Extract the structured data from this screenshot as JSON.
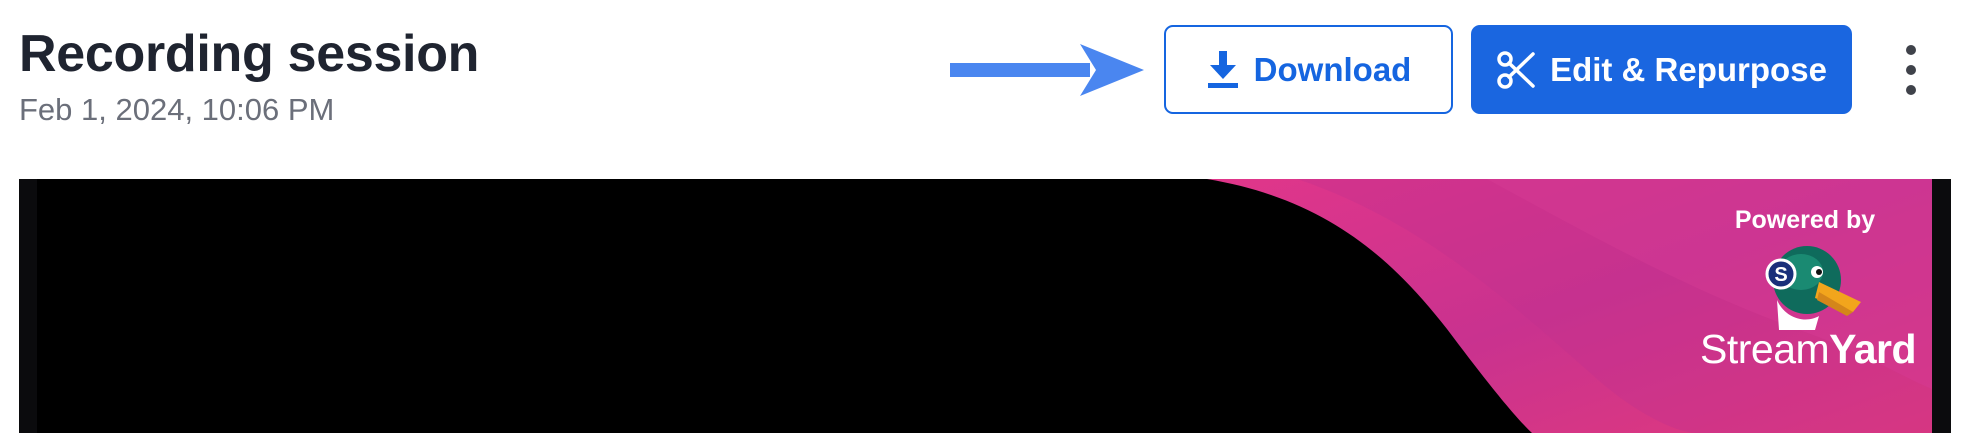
{
  "page": {
    "title": "Recording session",
    "date": "Feb 1, 2024, 10:06 PM"
  },
  "toolbar": {
    "download_label": "Download",
    "edit_label": "Edit & Repurpose",
    "download_icon": "download-icon",
    "edit_icon": "scissors-icon",
    "more_icon": "more-vertical-icon"
  },
  "annotation": {
    "arrow_icon": "arrow-right-icon",
    "arrow_color": "#4a86f0"
  },
  "video": {
    "powered_by": "Powered by",
    "brand_light": "Stream",
    "brand_bold": "Yard",
    "logo_badge": "S"
  },
  "colors": {
    "primary": "#1a66e0",
    "title_text": "#1f2430",
    "subtle_text": "#6b6f7a",
    "video_accent": "#e0368a"
  }
}
